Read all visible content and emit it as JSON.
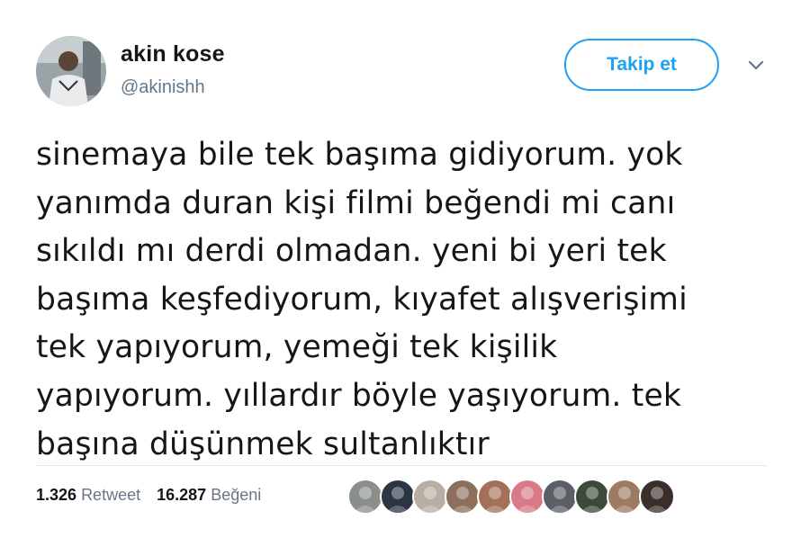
{
  "user": {
    "name": "akin kose",
    "handle": "@akinishh"
  },
  "follow_button_label": "Takip et",
  "tweet": {
    "lines": [
      "sinemaya bile tek başıma gidiyorum. yok",
      "yanımda duran kişi filmi beğendi mi canı",
      "sıkıldı mı derdi olmadan. yeni bi yeri tek",
      "başıma keşfediyorum, kıyafet alışverişimi",
      "tek yapıyorum, yemeği tek kişilik",
      "yapıyorum. yıllardır böyle yaşıyorum. tek",
      "başına düşünmek sultanlıktır"
    ]
  },
  "stats": {
    "retweets_count": "1.326",
    "retweets_label": "Retweet",
    "likes_count": "16.287",
    "likes_label": "Beğeni"
  },
  "likers": [
    {
      "icon": "liker-avatar",
      "bg": "#8a8f8c"
    },
    {
      "icon": "liker-avatar",
      "bg": "#2c3642"
    },
    {
      "icon": "liker-avatar",
      "bg": "#b9aea3"
    },
    {
      "icon": "liker-avatar",
      "bg": "#8d6f5c"
    },
    {
      "icon": "liker-avatar",
      "bg": "#a5705a"
    },
    {
      "icon": "liker-avatar",
      "bg": "#d97a88"
    },
    {
      "icon": "liker-avatar",
      "bg": "#5b5f66"
    },
    {
      "icon": "liker-avatar",
      "bg": "#3d4a3a"
    },
    {
      "icon": "liker-avatar",
      "bg": "#9d7b63"
    },
    {
      "icon": "liker-avatar",
      "bg": "#3a2f2a"
    }
  ],
  "colors": {
    "accent": "#1da1f2",
    "secondary_text": "#657786",
    "primary_text": "#14171a",
    "divider": "#e1e8ed"
  }
}
